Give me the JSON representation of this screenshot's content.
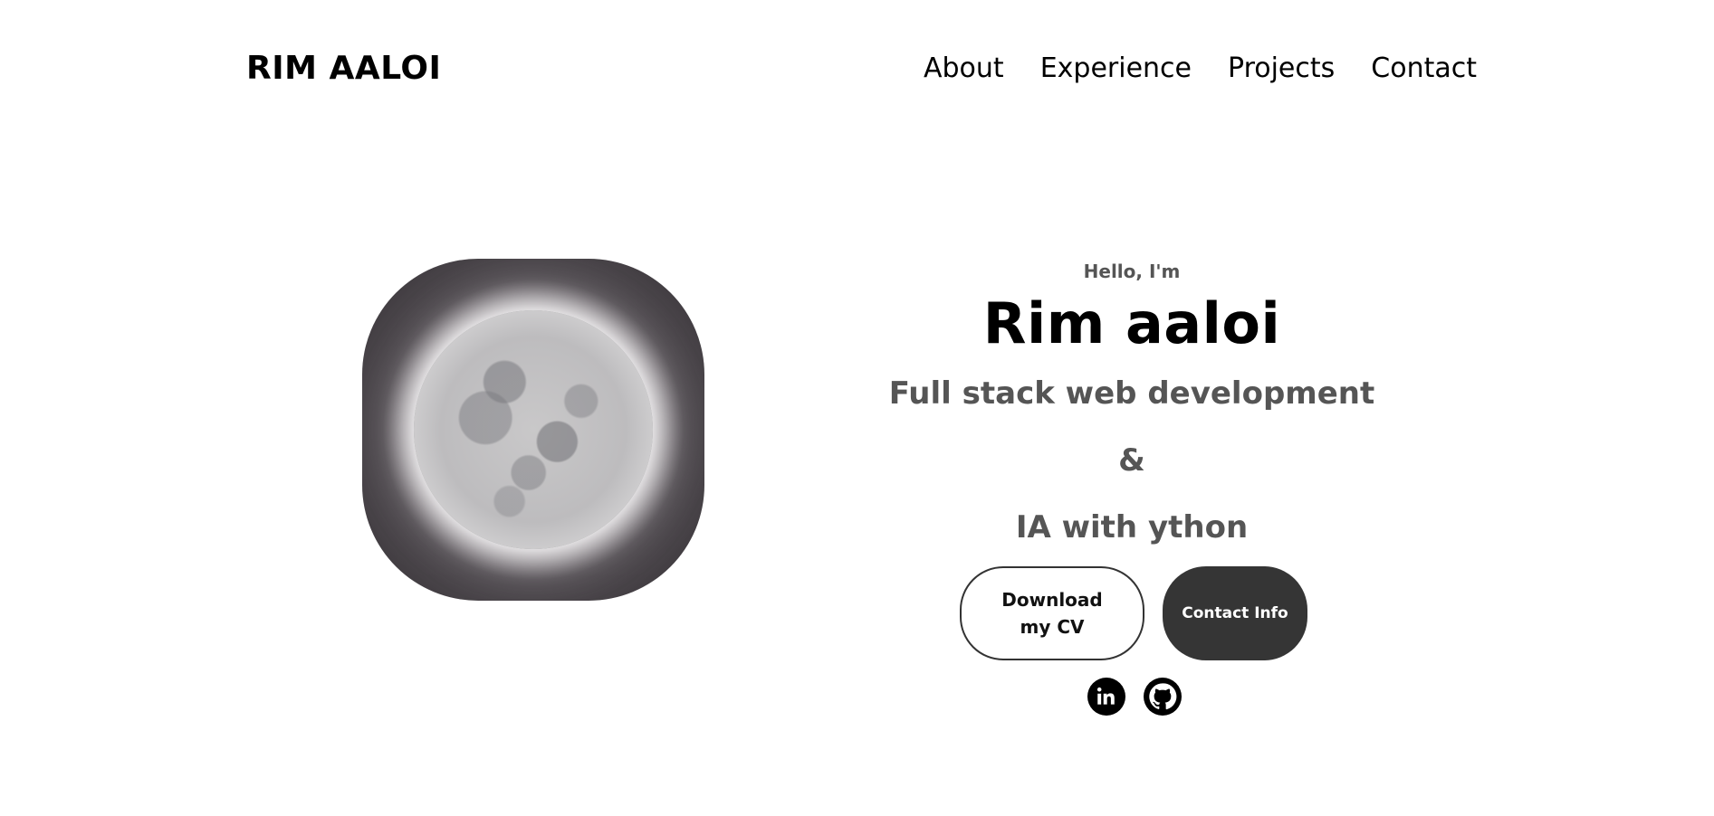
{
  "nav": {
    "logo": "RIM AALOI",
    "links": [
      "About",
      "Experience",
      "Projects",
      "Contact"
    ]
  },
  "profile": {
    "image": "moon-profile-picture"
  },
  "hero": {
    "greeting": "Hello, I'm",
    "name": "Rim aaloi",
    "role_line1": "Full stack web development",
    "role_line2": "&",
    "role_line3": "IA with ython"
  },
  "buttons": {
    "cv_label": "Download my CV",
    "contact_label": "Contact Info"
  },
  "socials": [
    {
      "icon": "linkedin-icon"
    },
    {
      "icon": "github-icon"
    }
  ],
  "colors": {
    "background": "#ffffff",
    "text": "#000000",
    "muted_text": "#555555",
    "dark_button": "#353535"
  }
}
